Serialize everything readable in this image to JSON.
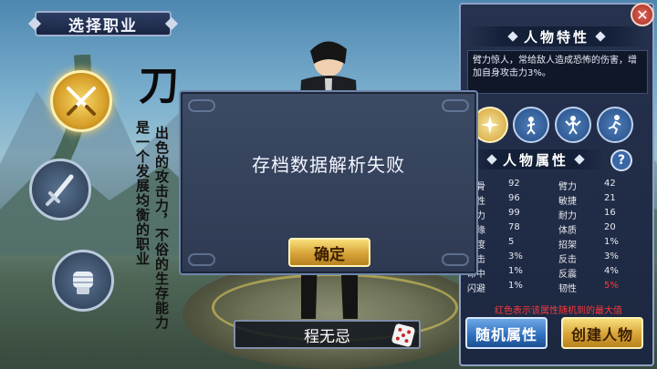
{
  "title": "选择职业",
  "classes": [
    {
      "icon": "crossed-swords-icon",
      "active": true
    },
    {
      "icon": "sword-icon",
      "active": false
    },
    {
      "icon": "fist-icon",
      "active": false
    }
  ],
  "calligraphy": {
    "big": "刀",
    "line1": "出色的攻击力，不俗的生存能力",
    "line2": "是一个发展均衡的职业"
  },
  "dialog": {
    "message": "存档数据解析失败",
    "confirm": "确定"
  },
  "character": {
    "name": "程无忌"
  },
  "panel": {
    "traits_title": "人物特性",
    "trait_desc": "臂力惊人，常给敌人造成恐怖的伤害，增加自身攻击力3%。",
    "skills": [
      "burst-icon",
      "axe-warrior-icon",
      "flex-icon",
      "runner-icon"
    ],
    "attrs_title": "人物属性",
    "help": "?",
    "stats": [
      {
        "l": "根骨",
        "lv": "92",
        "r": "臂力",
        "rv": "42"
      },
      {
        "l": "悟性",
        "lv": "96",
        "r": "敏捷",
        "rv": "21"
      },
      {
        "l": "魅力",
        "lv": "99",
        "r": "耐力",
        "rv": "16"
      },
      {
        "l": "福缘",
        "lv": "78",
        "r": "体质",
        "rv": "20"
      },
      {
        "l": "速度",
        "lv": "5",
        "r": "招架",
        "rv": "1%"
      },
      {
        "l": "暴击",
        "lv": "3%",
        "r": "反击",
        "rv": "3%"
      },
      {
        "l": "命中",
        "lv": "1%",
        "r": "反震",
        "rv": "4%"
      },
      {
        "l": "闪避",
        "lv": "1%",
        "r": "韧性",
        "rv": "5%"
      }
    ],
    "note": "红色表示该属性随机到的最大值",
    "random_btn": "随机属性",
    "create_btn": "创建人物"
  },
  "close": "✕",
  "colors": {
    "accent_gold": "#d7a338",
    "panel_bg": "#1c2740",
    "max_red": "#ff3b3b"
  }
}
